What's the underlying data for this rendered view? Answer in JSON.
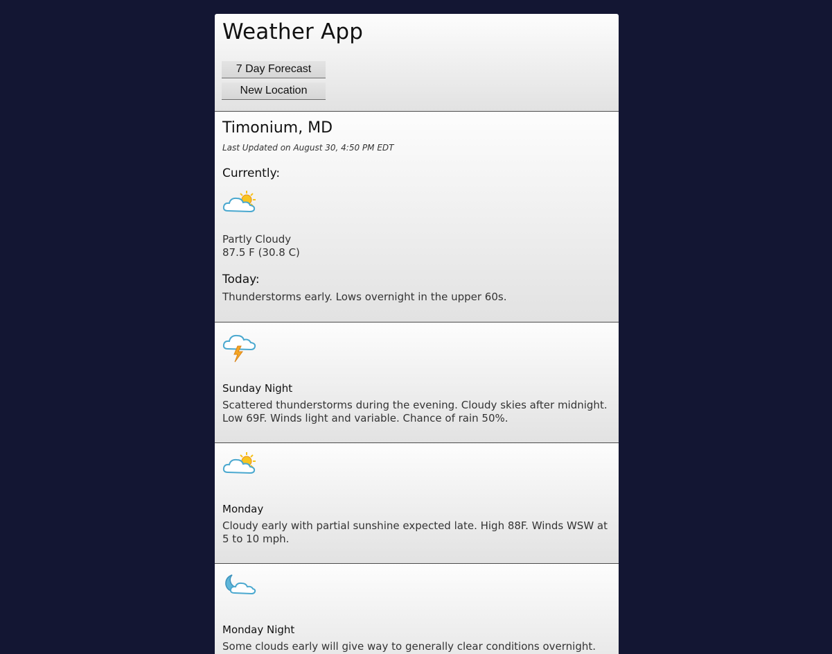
{
  "app": {
    "title": "Weather App",
    "forecast_button": "7 Day Forecast",
    "location_button": "New Location"
  },
  "current": {
    "location": "Timonium, MD",
    "updated": "Last Updated on August 30, 4:50 PM EDT",
    "currently_heading": "Currently:",
    "icon": "partly-cloudy-icon",
    "condition": "Partly Cloudy",
    "temperature": "87.5 F (30.8 C)",
    "today_heading": "Today:",
    "today_text": "Thunderstorms early. Lows overnight in the upper 60s."
  },
  "forecast": [
    {
      "icon": "thunderstorm-icon",
      "name": "Sunday Night",
      "text": "Scattered thunderstorms during the evening. Cloudy skies after midnight. Low 69F. Winds light and variable. Chance of rain 50%."
    },
    {
      "icon": "partly-cloudy-icon",
      "name": "Monday",
      "text": "Cloudy early with partial sunshine expected late. High 88F. Winds WSW at 5 to 10 mph."
    },
    {
      "icon": "partly-cloudy-night-icon",
      "name": "Monday Night",
      "text": "Some clouds early will give way to generally clear conditions overnight."
    }
  ],
  "colors": {
    "background": "#131633",
    "cloud_stroke": "#4aa8cf",
    "sun": "#f7c21b",
    "bolt": "#f5a623",
    "moon": "#5fb6d9"
  }
}
